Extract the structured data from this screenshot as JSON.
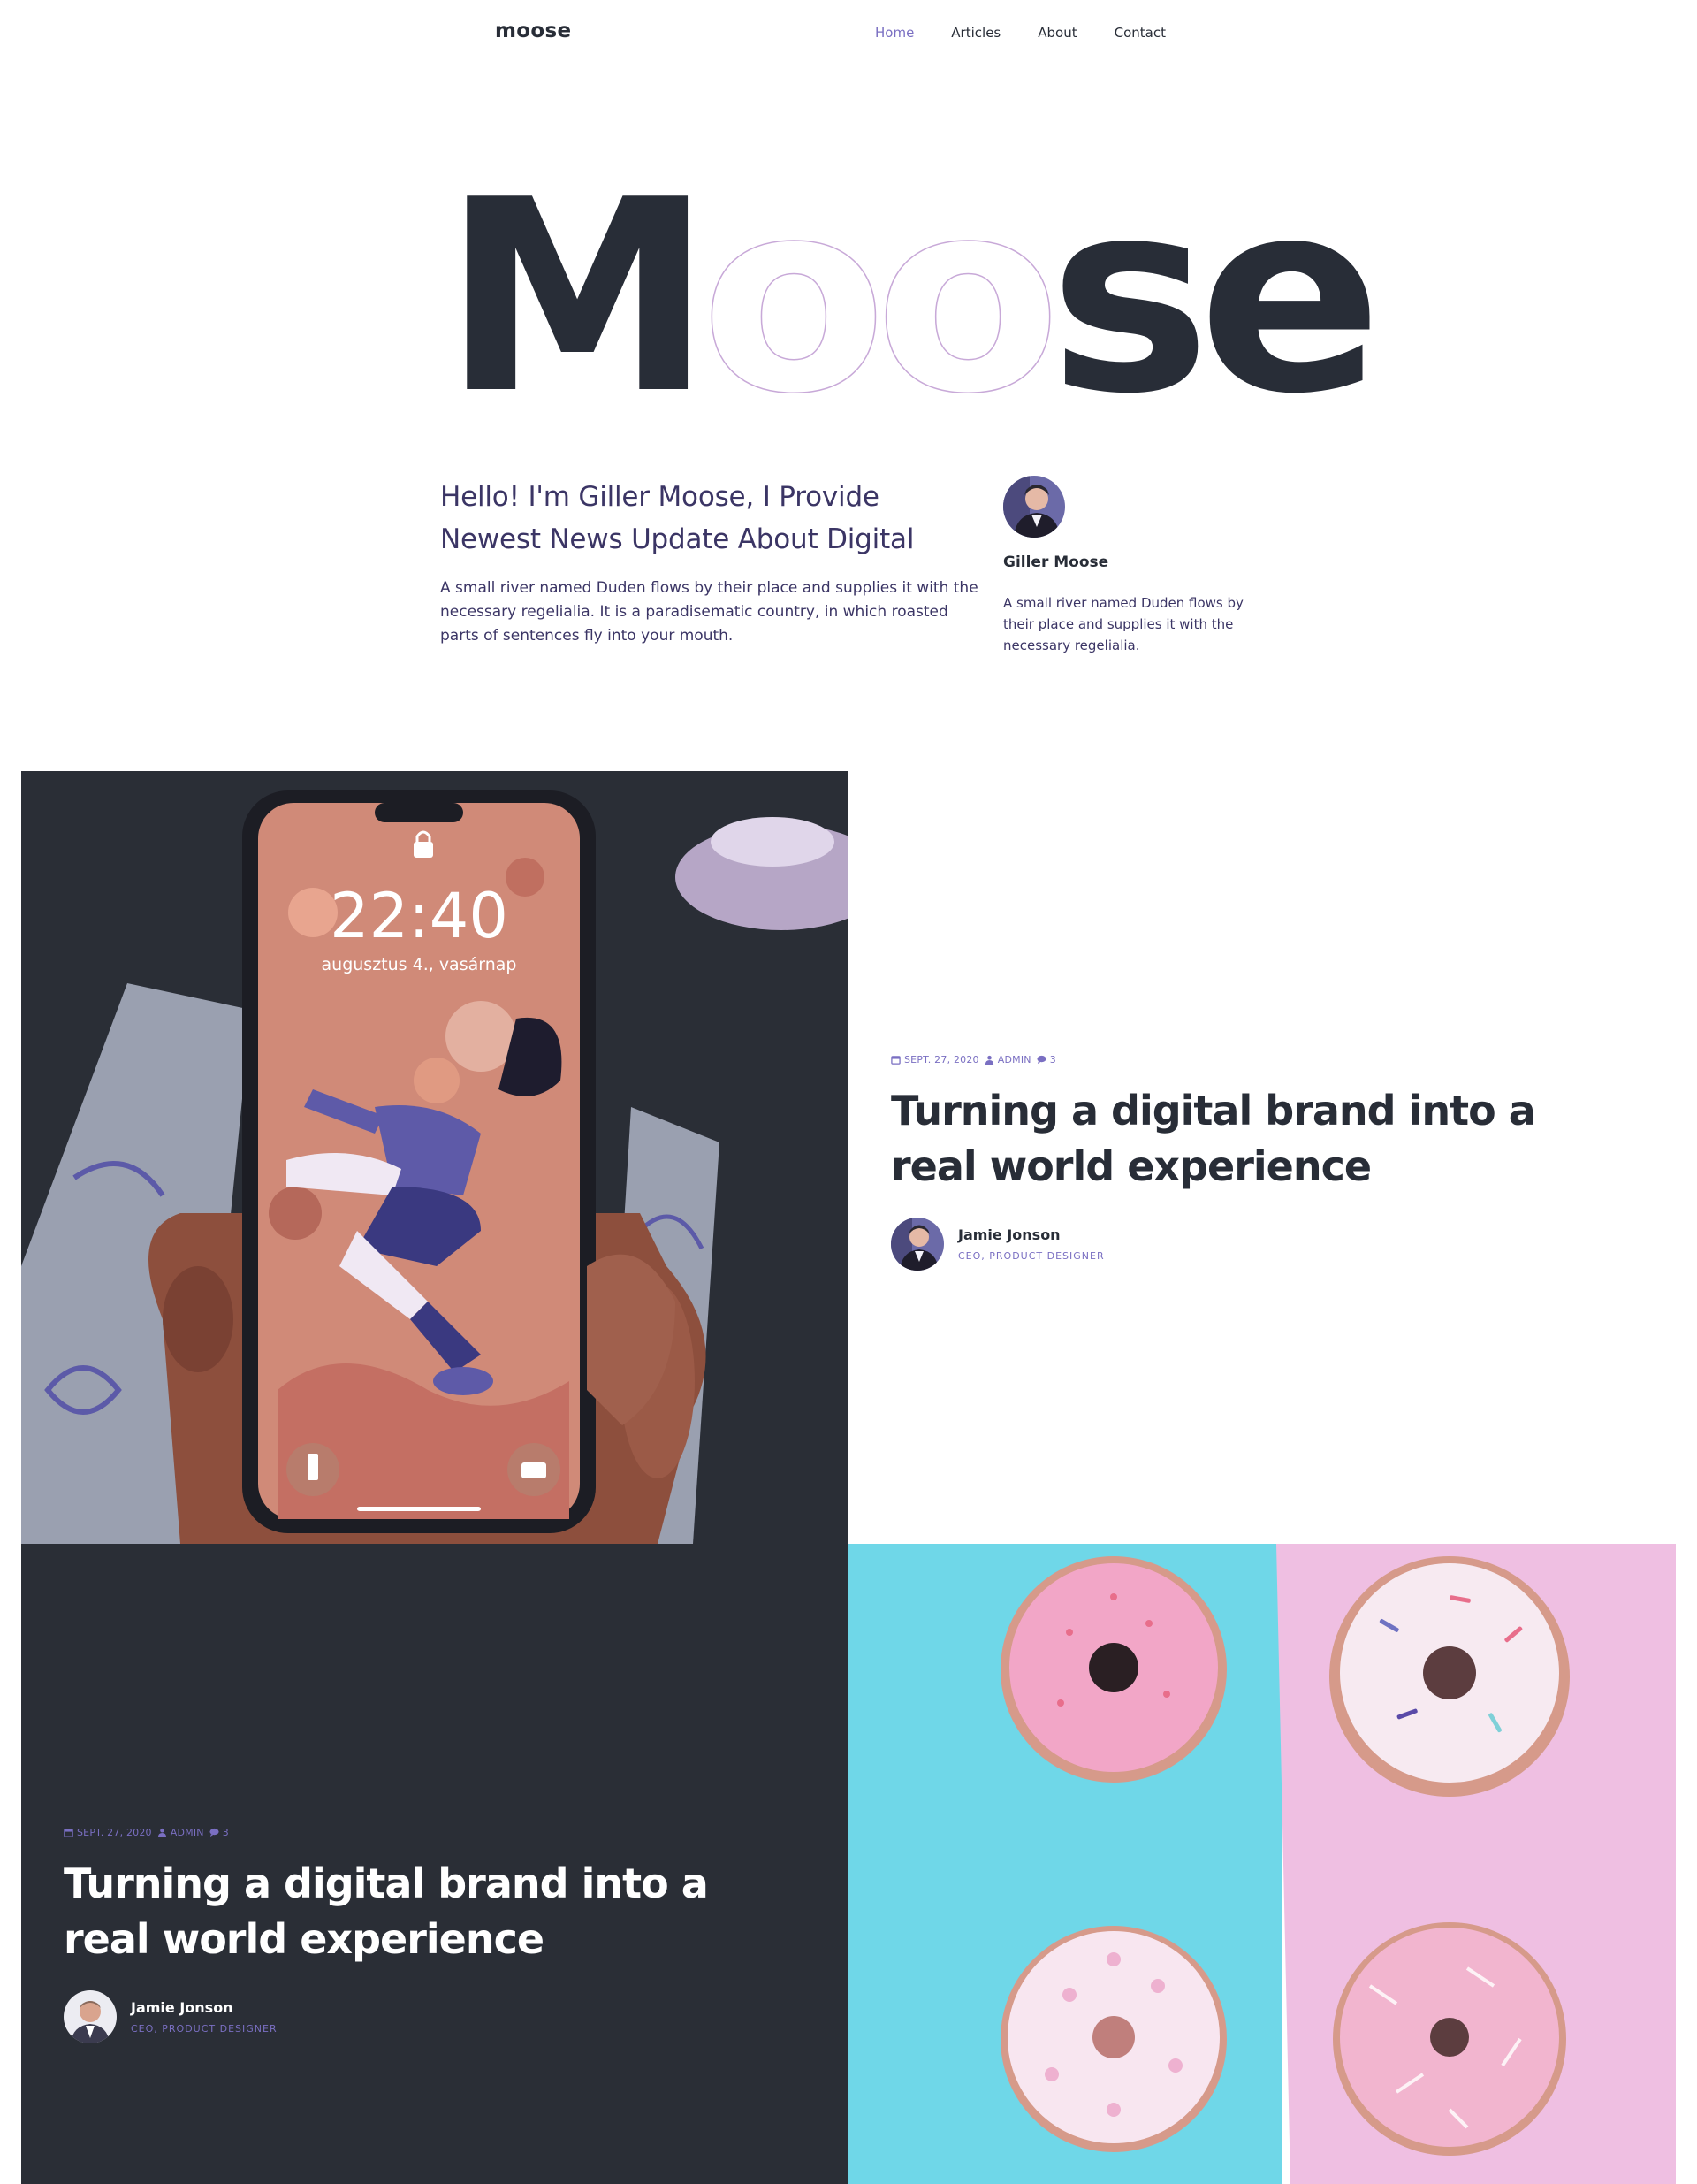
{
  "nav": {
    "logo": "moose",
    "items": [
      {
        "label": "Home",
        "active": true
      },
      {
        "label": "Articles",
        "active": false
      },
      {
        "label": "About",
        "active": false
      },
      {
        "label": "Contact",
        "active": false
      }
    ]
  },
  "hero": {
    "big_word": "Moose",
    "intro_title": "Hello! I'm Giller Moose, I Provide Newest News Update About Digital",
    "intro_text": "A small river named Duden flows by their place and supplies it with the necessary regelialia. It is a paradisematic country, in which roasted parts of sentences fly into your mouth."
  },
  "author": {
    "name": "Giller Moose",
    "bio": "A small river named Duden flows by their place and supplies it with the necessary regelialia."
  },
  "posts": [
    {
      "date": "Sept. 27, 2020",
      "author_tag": "Admin",
      "comments": "3",
      "title": "Turning a digital brand into a real world experience",
      "byline_name": "Jamie Jonson",
      "byline_role": "CEO, Product Designer"
    },
    {
      "date": "Sept. 27, 2020",
      "author_tag": "Admin",
      "comments": "3",
      "title": "Turning a digital brand into a real world experience",
      "byline_name": "Jamie Jonson",
      "byline_role": "CEO, Product Designer"
    }
  ],
  "phone_screen": {
    "time": "22:40",
    "date": "augusztus 4., vasárnap"
  },
  "colors": {
    "dark": "#2a2e36",
    "accent": "#7a6fc2",
    "cyan": "#6fd7e8",
    "pink": "#efbfe2"
  }
}
